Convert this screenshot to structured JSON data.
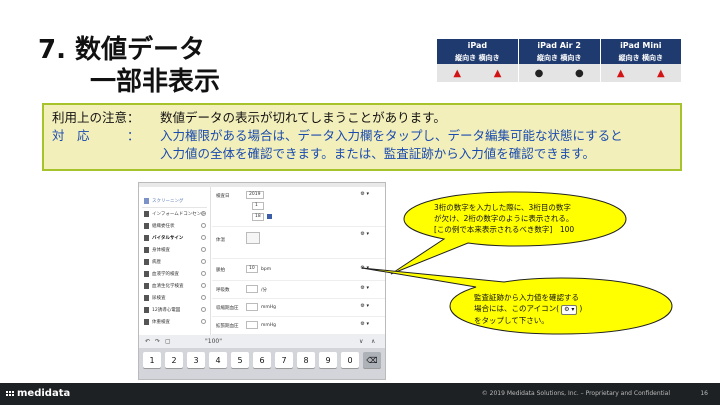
{
  "title": {
    "line1": "7.  数値データ",
    "line2": "一部非表示"
  },
  "devices": {
    "headers": [
      "iPad",
      "iPad Air 2",
      "iPad Mini"
    ],
    "sub": [
      "縦向き  横向き",
      "縦向き  横向き",
      "縦向き  横向き"
    ],
    "marks": [
      "▲",
      "▲",
      "●",
      "●",
      "▲",
      "▲"
    ],
    "colors": {
      "triangle": "#d21414",
      "dot": "#222222",
      "header_bg": "#1e3a6e"
    }
  },
  "notice": {
    "label1": "利用上の注意：",
    "text1": "数値データの表示が切れてしまうことがあります。",
    "label2": "対　応　　　：",
    "text2a": "入力権限がある場合は、データ入力欄をタップし、データ編集可能な状態にすると",
    "text2b": "入力値の全体を確認できます。または、監査証跡から入力値を確認できます。"
  },
  "app": {
    "sidebar": [
      {
        "label": "スクリーニング",
        "type": "hdr"
      },
      {
        "label": "インフォームドコンセント"
      },
      {
        "label": "組織委任状"
      },
      {
        "label": "バイタルサイン",
        "type": "bold"
      },
      {
        "label": "身体検査"
      },
      {
        "label": "病歴"
      },
      {
        "label": "血液学的検査"
      },
      {
        "label": "血清生化学検査"
      },
      {
        "label": "尿検査"
      },
      {
        "label": "12誘導心電図"
      },
      {
        "label": "体重検査"
      }
    ],
    "fields": {
      "date_label": "検査日",
      "year": "2019",
      "month": "1",
      "day": "18",
      "photo_label": "体温",
      "pulse_label": "脈拍",
      "pulse_value": "10",
      "pulse_unit": "bpm",
      "resp_label": "呼吸数",
      "resp_unit": "/分",
      "sbp_label": "収縮期血圧",
      "sbp_unit": "mmHg",
      "dbp_label": "拡張期血圧",
      "dbp_unit": "mmHg",
      "gear": "⚙ ▾"
    },
    "keyboard": {
      "suggestion": "\"100\"",
      "keys": [
        "1",
        "2",
        "3",
        "4",
        "5",
        "6",
        "7",
        "8",
        "9",
        "0"
      ],
      "delete": "⌫"
    }
  },
  "callout1": {
    "line1": "3桁の数字を入力した際に、3桁目の数字",
    "line2": "が欠け、2桁の数字のように表示される。",
    "line3": "[この例で本来表示されるべき数字]　100"
  },
  "callout2": {
    "line1": "監査証跡から入力値を確認する",
    "line2a": "場合には、このアイコン(",
    "icon": "⚙ ▾",
    "line2b": ")",
    "line3": "をタップして下さい。"
  },
  "footer": {
    "logo": "medidata",
    "copyright": "© 2019 Medidata Solutions, Inc. – Proprietary and Confidential",
    "page": "16"
  }
}
